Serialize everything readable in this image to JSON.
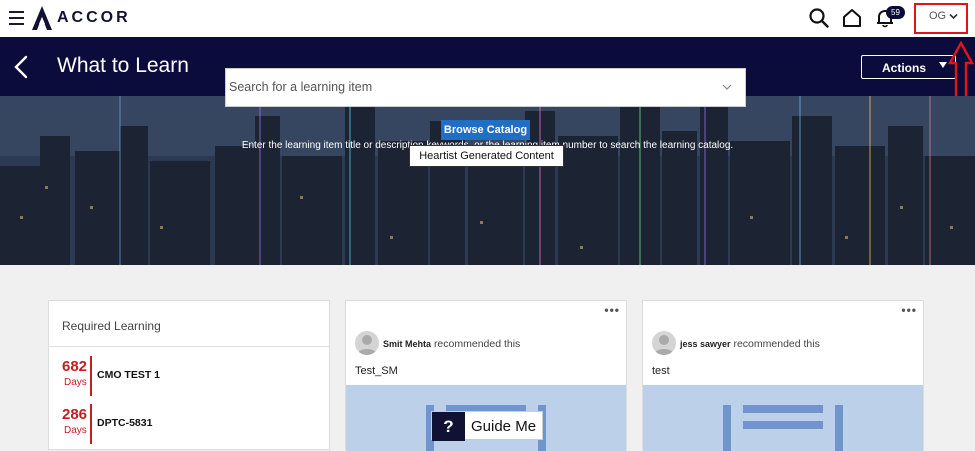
{
  "topbar": {
    "logo_text": "ACCOR",
    "notification_count": "59",
    "user_initials": "OG"
  },
  "header": {
    "title": "What to Learn",
    "actions_label": "Actions"
  },
  "hero": {
    "caption": "Enter the learning item title or description keywords, or the learning item number to search the learning catalog.",
    "search_placeholder": "Search for a learning item",
    "browse_label": "Browse Catalog",
    "heartist_label": "Heartist Generated Content"
  },
  "required_learning": {
    "title": "Required Learning",
    "items": [
      {
        "days": "682",
        "days_label": "Days",
        "name": "CMO TEST 1"
      },
      {
        "days": "286",
        "days_label": "Days",
        "name": "DPTC-5831"
      }
    ]
  },
  "recommendations": [
    {
      "user": "Smit Mehta",
      "action": "recommended this",
      "item": "Test_SM"
    },
    {
      "user": "jess sawyer",
      "action": "recommended this",
      "item": "test"
    }
  ],
  "guide": {
    "icon": "?",
    "label": "Guide Me"
  },
  "colors": {
    "header_bg": "#0c0c3c",
    "accent_red": "#c41e24",
    "browse_blue": "#1f6fc6",
    "highlight_red": "#e0141b"
  }
}
